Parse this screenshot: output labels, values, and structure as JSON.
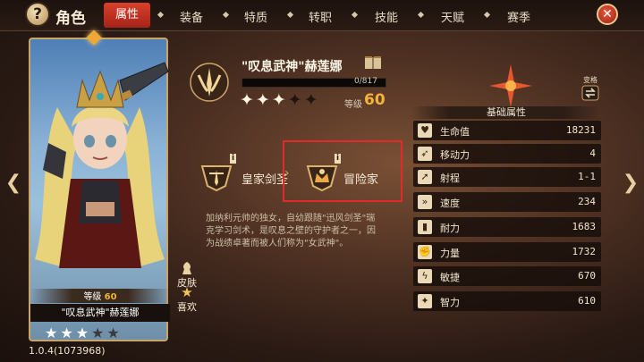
{
  "header": {
    "help_icon": "?",
    "title": "角色",
    "tabs": [
      {
        "label": "属性",
        "active": true
      },
      {
        "label": "装备",
        "active": false
      },
      {
        "label": "特质",
        "active": false
      },
      {
        "label": "转职",
        "active": false
      },
      {
        "label": "技能",
        "active": false
      },
      {
        "label": "天赋",
        "active": false
      },
      {
        "label": "赛季",
        "active": false
      }
    ],
    "close_icon": "close-icon"
  },
  "card": {
    "level_label": "等级",
    "level": "60",
    "name": "\"叹息武神\"赫莲娜",
    "stars_filled": 3,
    "stars_total": 5
  },
  "side_buttons": {
    "skin": "皮肤",
    "like": "喜欢"
  },
  "build": "1.0.4(1073968)",
  "hero": {
    "name": "\"叹息武神\"赫莲娜",
    "exp_text": "0/817",
    "exp_fraction": 0,
    "stars_filled": 3,
    "stars_total": 5,
    "level_label": "等级",
    "level": "60"
  },
  "job": {
    "from_label": "皇家剑圣",
    "to_label": "冒险家",
    "info_mark": "i"
  },
  "description": "加纳利元帅的独女，自幼跟随\"迅风剑圣\"瑞克学习剑术，是叹息之壁的守护者之一，因为战绩卓著而被人们称为\"女武神\"。",
  "attributes": {
    "swap_label": "变格",
    "title": "基础属性",
    "rows": [
      {
        "icon": "heart-icon",
        "glyph": "♥",
        "name": "生命值",
        "value": "18231"
      },
      {
        "icon": "boot-icon",
        "glyph": "➶",
        "name": "移动力",
        "value": "4"
      },
      {
        "icon": "range-icon",
        "glyph": "➚",
        "name": "射程",
        "value": "1-1"
      },
      {
        "icon": "speed-icon",
        "glyph": "»",
        "name": "速度",
        "value": "234"
      },
      {
        "icon": "endurance-icon",
        "glyph": "▮",
        "name": "耐力",
        "value": "1683"
      },
      {
        "icon": "strength-icon",
        "glyph": "✊",
        "name": "力量",
        "value": "1732"
      },
      {
        "icon": "agility-icon",
        "glyph": "ϟ",
        "name": "敏捷",
        "value": "670"
      },
      {
        "icon": "intellect-icon",
        "glyph": "✦",
        "name": "智力",
        "value": "610"
      }
    ]
  },
  "colors": {
    "accent_red": "#c52d20",
    "gold": "#f4b43b",
    "highlight": "#e32a2a"
  }
}
